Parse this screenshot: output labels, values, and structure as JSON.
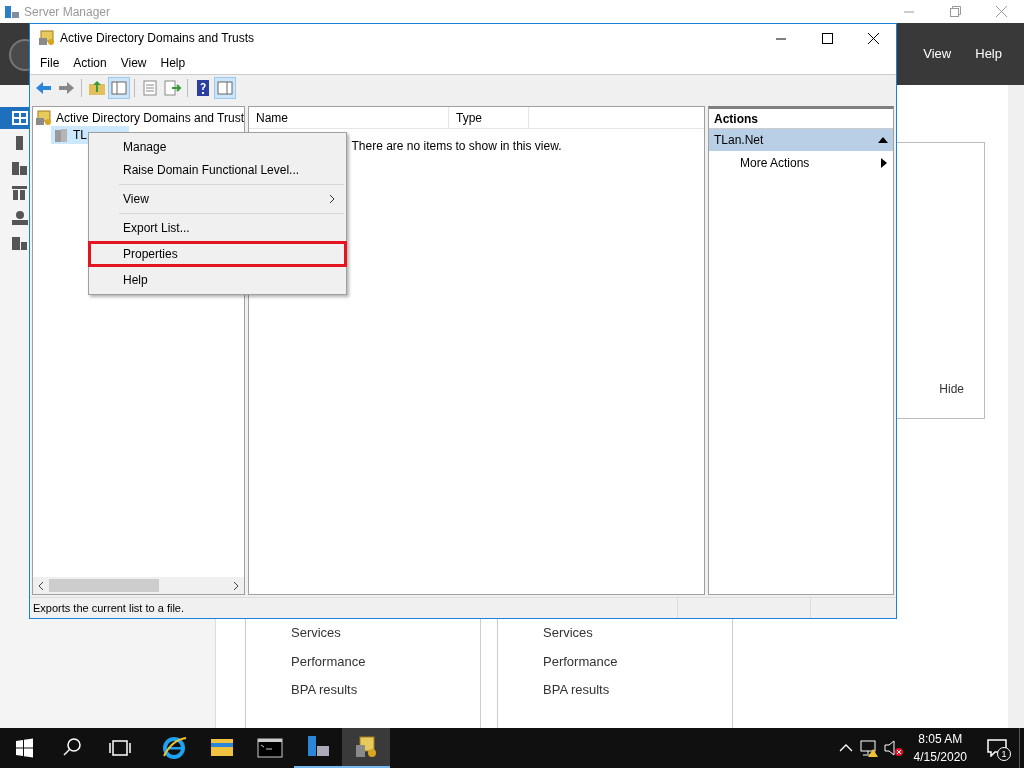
{
  "server_manager": {
    "title": "Server Manager",
    "header_menu": [
      "View",
      "Help"
    ],
    "nav": [
      {
        "selected": true
      },
      {
        "selected": false
      },
      {
        "selected": false
      },
      {
        "selected": false
      },
      {
        "selected": false
      },
      {
        "selected": false
      }
    ],
    "side_panel": {
      "button": "Hide"
    },
    "tiles": [
      {
        "items": [
          "Services",
          "Performance",
          "BPA results"
        ]
      },
      {
        "items": [
          "Services",
          "Performance",
          "BPA results"
        ]
      }
    ]
  },
  "window": {
    "title": "Active Directory Domains and Trusts",
    "menu": [
      "File",
      "Action",
      "View",
      "Help"
    ],
    "tree": {
      "root": "Active Directory Domains and Trust",
      "children": [
        {
          "label": "TL",
          "selected": true
        }
      ]
    },
    "list": {
      "columns": [
        "Name",
        "Type"
      ],
      "empty_message": "There are no items to show in this view."
    },
    "actions": {
      "title": "Actions",
      "groups": [
        {
          "label": "TLan.Net",
          "expanded": true,
          "items": [
            "More Actions"
          ]
        }
      ]
    },
    "status_bar": "Exports the current list to a file."
  },
  "context_menu": [
    {
      "kind": "item",
      "label": "Manage",
      "marked": false
    },
    {
      "kind": "item",
      "label": "Raise Domain Functional Level...",
      "marked": false
    },
    {
      "kind": "separator"
    },
    {
      "kind": "submenu",
      "label": "View",
      "marked": false
    },
    {
      "kind": "separator"
    },
    {
      "kind": "item",
      "label": "Export List...",
      "marked": false
    },
    {
      "kind": "item",
      "label": "Properties",
      "marked": true
    },
    {
      "kind": "item",
      "label": "Help",
      "marked": false
    }
  ],
  "taskbar": {
    "apps": [
      {
        "kind": "ie",
        "active": false
      },
      {
        "kind": "explorer",
        "active": false
      },
      {
        "kind": "cmd",
        "active": false
      },
      {
        "kind": "servermanager",
        "active": false
      },
      {
        "kind": "addt",
        "active": true
      }
    ],
    "time": "8:05 AM",
    "date": "4/15/2020",
    "notifications": "1"
  }
}
